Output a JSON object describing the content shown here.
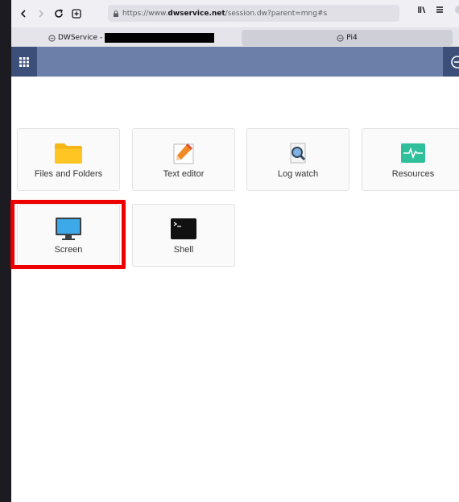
{
  "browser": {
    "url_prefix": "https://www.",
    "url_domain": "dwservice.net",
    "url_path": "/session.dw?parent=mng#s",
    "tabs": [
      {
        "label": "DWService -"
      },
      {
        "label": "Pi4"
      }
    ]
  },
  "apps": [
    {
      "label": "Files and Folders",
      "icon": "folder-icon"
    },
    {
      "label": "Text editor",
      "icon": "text-editor-icon"
    },
    {
      "label": "Log watch",
      "icon": "log-watch-icon"
    },
    {
      "label": "Resources",
      "icon": "resources-icon"
    },
    {
      "label": "Screen",
      "icon": "screen-icon"
    },
    {
      "label": "Shell",
      "icon": "shell-icon"
    }
  ],
  "colors": {
    "appbar": "#6b7fa8",
    "appbar_dark": "#3b4f78",
    "highlight": "#ee0000"
  }
}
